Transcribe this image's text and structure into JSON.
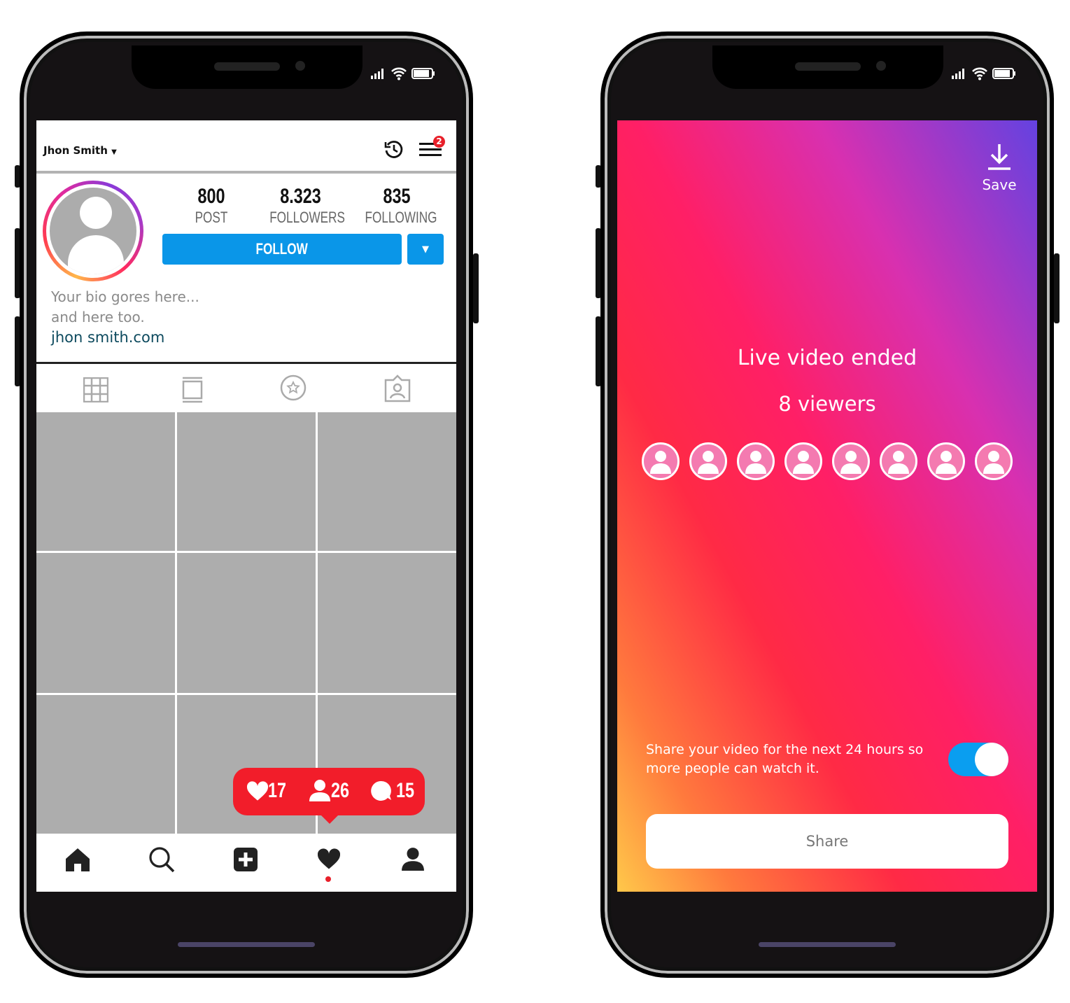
{
  "profile_screen": {
    "username": "Jhon Smith",
    "notification_badge": "2",
    "stats": [
      {
        "value": "800",
        "label": "POST"
      },
      {
        "value": "8.323",
        "label": "FOLLOWERS"
      },
      {
        "value": "835",
        "label": "FOLLOWING"
      }
    ],
    "follow_label": "FOLLOW",
    "bio_line1": "Your bio gores here...",
    "bio_line2": "and here too.",
    "website": "jhon smith.com",
    "activity_popup": {
      "likes": "17",
      "followers": "26",
      "comments": "15"
    },
    "colors": {
      "accent": "#0a96e8",
      "popup": "#f21d2a"
    }
  },
  "live_screen": {
    "save_label": "Save",
    "title": "Live video ended",
    "viewers_label": "8 viewers",
    "viewer_count": 8,
    "share_text": "Share your video for the next 24 hours so more people can watch it.",
    "toggle_on": true,
    "share_button": "Share"
  }
}
